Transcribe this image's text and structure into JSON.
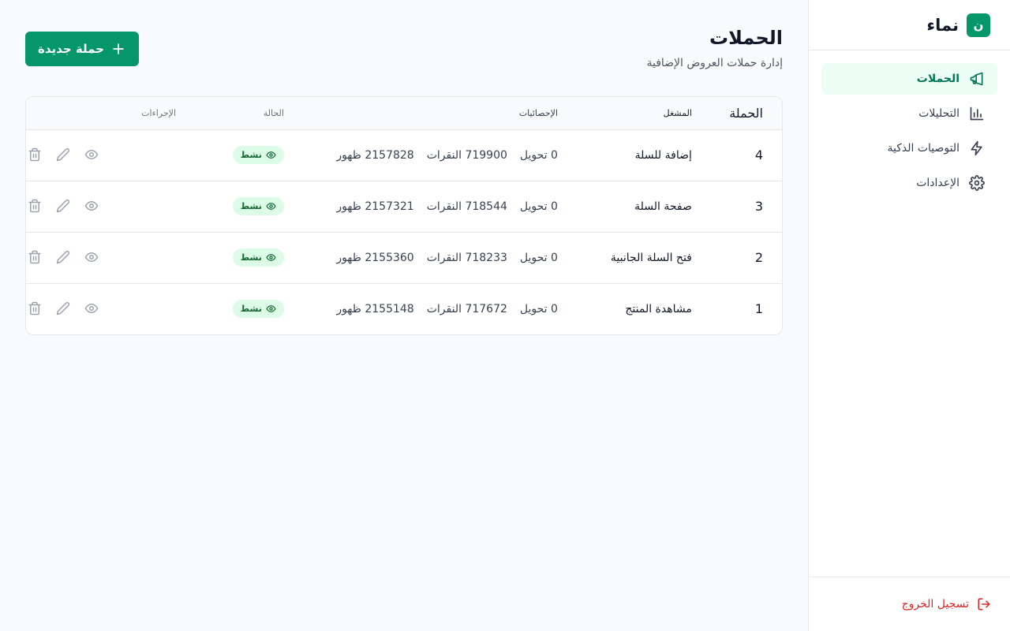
{
  "brand": {
    "logo_letter": "ن",
    "name": "نماء"
  },
  "sidebar": {
    "items": [
      {
        "label": "الحملات",
        "icon": "megaphone-icon",
        "active": true
      },
      {
        "label": "التحليلات",
        "icon": "bar-chart-icon",
        "active": false
      },
      {
        "label": "التوصيات الذكية",
        "icon": "lightning-icon",
        "active": false
      },
      {
        "label": "الإعدادات",
        "icon": "gear-icon",
        "active": false
      }
    ],
    "logout_label": "تسجيل الخروج"
  },
  "header": {
    "title": "الحملات",
    "subtitle": "إدارة حملات العروض الإضافية",
    "new_button_label": "حملة جديدة"
  },
  "table": {
    "columns": {
      "campaign": "الحملة",
      "trigger": "المشغل",
      "stats": "الإحصائيات",
      "status": "الحالة",
      "actions": "الإجراءات"
    },
    "rows": [
      {
        "id": "4",
        "trigger": "إضافة للسلة",
        "conversions": "0 تحويل",
        "clicks": "719900 النقرات",
        "views": "2157828 ظهور",
        "status": "نشط"
      },
      {
        "id": "3",
        "trigger": "صفحة السلة",
        "conversions": "0 تحويل",
        "clicks": "718544 النقرات",
        "views": "2157321 ظهور",
        "status": "نشط"
      },
      {
        "id": "2",
        "trigger": "فتح السلة الجانبية",
        "conversions": "0 تحويل",
        "clicks": "718233 النقرات",
        "views": "2155360 ظهور",
        "status": "نشط"
      },
      {
        "id": "1",
        "trigger": "مشاهدة المنتج",
        "conversions": "0 تحويل",
        "clicks": "717672 النقرات",
        "views": "2155148 ظهور",
        "status": "نشط"
      }
    ]
  },
  "colors": {
    "accent": "#059669",
    "active_bg": "#ecfdf5",
    "danger": "#dc2626",
    "badge_bg": "#dcfce7"
  }
}
